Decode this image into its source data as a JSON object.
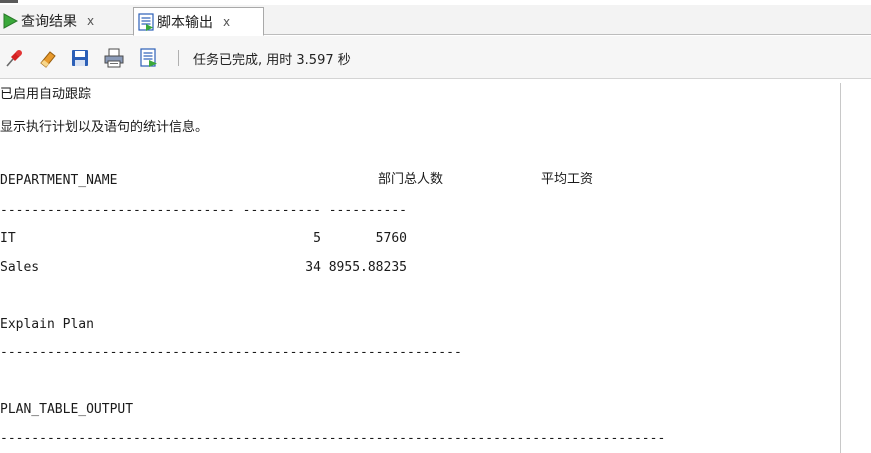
{
  "tabs": [
    {
      "label": "查询结果",
      "close": "x",
      "active": false
    },
    {
      "label": "脚本输出",
      "close": "x",
      "active": true
    }
  ],
  "toolbar": {
    "icons": [
      "pin-icon",
      "eraser-icon",
      "save-icon",
      "print-icon",
      "script-icon"
    ],
    "separator": "|",
    "status": "任务已完成, 用时 3.597 秒"
  },
  "output": {
    "lines": [
      "已启用自动跟踪",
      "显示执行计划以及语句的统计信息。",
      "",
      "DEPARTMENT_NAME",
      "------------------------------ ---------- ----------",
      "IT                                      5       5760",
      "Sales                                  34 8955.88235",
      "",
      "Explain Plan",
      "-----------------------------------------------------------",
      "",
      "PLAN_TABLE_OUTPUT",
      "-------------------------------------------------------------------------------------"
    ],
    "col_header_count": "部门总人数",
    "col_header_avg": "平均工资"
  },
  "colors": {
    "tab_active_bg": "#ffffff",
    "tabbar_bg": "#f3f3f3",
    "run_green": "#3aa83a",
    "pin_red": "#d42020",
    "eraser_orange": "#e89a2c",
    "save_blue": "#2b5fb7"
  }
}
